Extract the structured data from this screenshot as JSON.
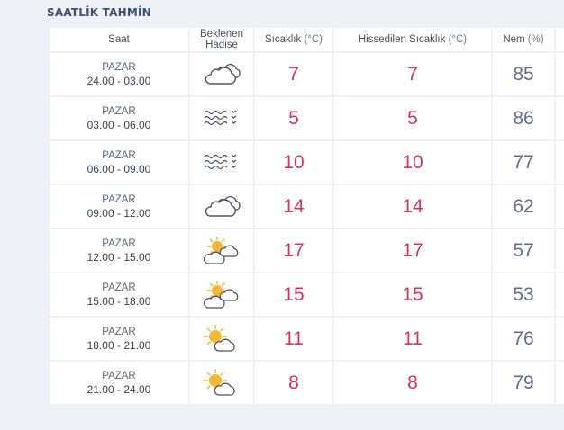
{
  "section_title": "SAATLİK TAHMİN",
  "headers": {
    "time": "Saat",
    "event_line1": "Beklenen",
    "event_line2": "Hadise",
    "temp_label": "Sıcaklık",
    "temp_unit": "(°C)",
    "feels_label": "Hissedilen Sıcaklık",
    "feels_unit": "(°C)",
    "humidity_label": "Nem",
    "humidity_unit": "(%)"
  },
  "rows": [
    {
      "day": "PAZAR",
      "range": "24.00 - 03.00",
      "icon": "cloudy-icon",
      "temp": "7",
      "feels": "7",
      "humidity": "85"
    },
    {
      "day": "PAZAR",
      "range": "03.00 - 06.00",
      "icon": "fog-icon",
      "temp": "5",
      "feels": "5",
      "humidity": "86"
    },
    {
      "day": "PAZAR",
      "range": "06.00 - 09.00",
      "icon": "fog-icon",
      "temp": "10",
      "feels": "10",
      "humidity": "77"
    },
    {
      "day": "PAZAR",
      "range": "09.00 - 12.00",
      "icon": "cloudy-icon",
      "temp": "14",
      "feels": "14",
      "humidity": "62"
    },
    {
      "day": "PAZAR",
      "range": "12.00 - 15.00",
      "icon": "partly-cloudy-icon",
      "temp": "17",
      "feels": "17",
      "humidity": "57"
    },
    {
      "day": "PAZAR",
      "range": "15.00 - 18.00",
      "icon": "partly-cloudy-icon",
      "temp": "15",
      "feels": "15",
      "humidity": "53"
    },
    {
      "day": "PAZAR",
      "range": "18.00 - 21.00",
      "icon": "mostly-sunny-icon",
      "temp": "11",
      "feels": "11",
      "humidity": "76"
    },
    {
      "day": "PAZAR",
      "range": "21.00 - 24.00",
      "icon": "mostly-sunny-icon",
      "temp": "8",
      "feels": "8",
      "humidity": "79"
    }
  ],
  "colors": {
    "temperature": "#d4365a",
    "humidity": "#646c8c",
    "title": "#3b5273",
    "sun": "#f5b733"
  }
}
